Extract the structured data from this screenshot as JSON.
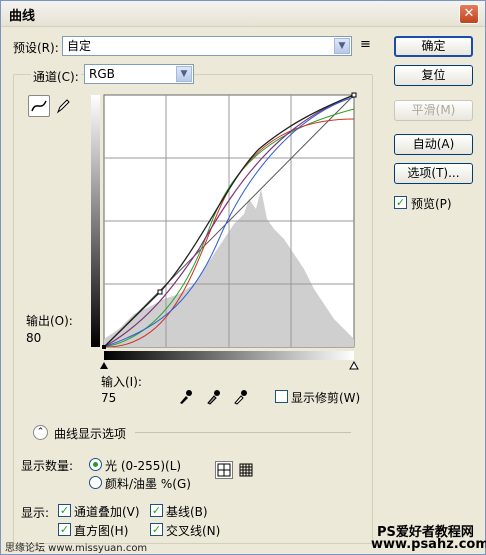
{
  "window": {
    "title": "曲线",
    "close": "✕"
  },
  "preset": {
    "label": "预设(R):",
    "value": "自定"
  },
  "buttons": {
    "ok": "确定",
    "reset": "复位",
    "smooth": "平滑(M)",
    "auto": "自动(A)",
    "options": "选项(T)..."
  },
  "preview": {
    "label": "预览(P)",
    "checked": true
  },
  "channel": {
    "label": "通道(C):",
    "value": "RGB"
  },
  "output": {
    "label": "输出(O):",
    "value": "80"
  },
  "input": {
    "label": "输入(I):",
    "value": "75"
  },
  "show_clipping": {
    "label": "显示修剪(W)"
  },
  "curve_options": {
    "label": "曲线显示选项"
  },
  "show_amount": {
    "label": "显示数量:",
    "light": "光 (0-255)(L)",
    "pigment": "颜料/油墨 %(G)"
  },
  "show": {
    "label": "显示:",
    "channel_overlay": "通道叠加(V)",
    "baseline": "基线(B)",
    "histogram": "直方图(H)",
    "intersection": "交叉线(N)"
  },
  "watermark": {
    "left": "思缘论坛 www.missyuan.com",
    "right1": "PS爱好者教程网",
    "right2": "www.psahz.com"
  },
  "colors": {
    "red": "#d03020",
    "green": "#2aa12a",
    "blue": "#2a5fd6",
    "composite": "#222222",
    "purple": "#80307a"
  },
  "icons": [
    "curve-tool-icon",
    "pencil-icon",
    "menu-lines-icon",
    "black-eyedropper-icon",
    "gray-eyedropper-icon",
    "white-eyedropper-icon",
    "collapse-icon",
    "grid-4-icon",
    "grid-10-icon"
  ]
}
